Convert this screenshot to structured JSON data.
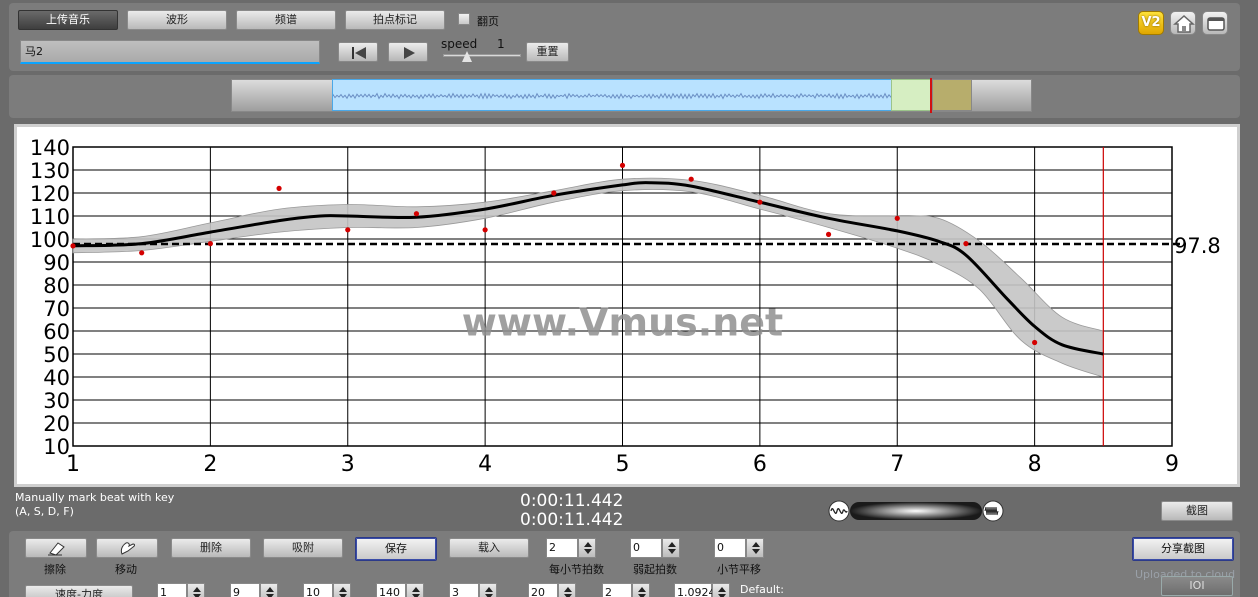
{
  "toolbar": {
    "upload_label": "上传音乐",
    "waveform_label": "波形",
    "spectrum_label": "频谱",
    "beat_mark_label": "拍点标记",
    "page_turn_label": "翻页",
    "song_title": "马2",
    "speed_label": "speed",
    "speed_value": "1",
    "reset_label": "重置",
    "version_badge": "V2",
    "home_icon": "home-icon",
    "window_icon": "window-icon"
  },
  "chart_data": {
    "type": "line",
    "title": "",
    "xlabel": "",
    "ylabel": "",
    "xlim": [
      1,
      9
    ],
    "ylim": [
      10,
      140
    ],
    "x_ticks": [
      1,
      2,
      3,
      4,
      5,
      6,
      7,
      8,
      9
    ],
    "y_ticks": [
      10,
      20,
      30,
      40,
      50,
      60,
      70,
      80,
      90,
      100,
      110,
      120,
      130,
      140
    ],
    "grid": true,
    "watermark": "www.Vmus.net",
    "reference_line": {
      "y": 97.8,
      "label": "97.8",
      "style": "dashed"
    },
    "cursor_x": 8.5,
    "points": [
      {
        "x": 1.0,
        "y": 97
      },
      {
        "x": 1.5,
        "y": 94
      },
      {
        "x": 2.0,
        "y": 98
      },
      {
        "x": 2.5,
        "y": 122
      },
      {
        "x": 3.0,
        "y": 104
      },
      {
        "x": 3.5,
        "y": 111
      },
      {
        "x": 4.0,
        "y": 104
      },
      {
        "x": 4.5,
        "y": 120
      },
      {
        "x": 5.0,
        "y": 132
      },
      {
        "x": 5.5,
        "y": 126
      },
      {
        "x": 6.0,
        "y": 116
      },
      {
        "x": 6.5,
        "y": 102
      },
      {
        "x": 7.0,
        "y": 109
      },
      {
        "x": 7.5,
        "y": 98
      },
      {
        "x": 8.0,
        "y": 55
      }
    ],
    "smooth_curve": [
      {
        "x": 1.0,
        "y": 97
      },
      {
        "x": 1.5,
        "y": 98
      },
      {
        "x": 2.0,
        "y": 103
      },
      {
        "x": 2.5,
        "y": 108
      },
      {
        "x": 2.8,
        "y": 110
      },
      {
        "x": 3.0,
        "y": 110
      },
      {
        "x": 3.5,
        "y": 109.5
      },
      {
        "x": 4.0,
        "y": 113
      },
      {
        "x": 4.5,
        "y": 119
      },
      {
        "x": 5.0,
        "y": 123.5
      },
      {
        "x": 5.2,
        "y": 124.5
      },
      {
        "x": 5.5,
        "y": 123
      },
      {
        "x": 6.0,
        "y": 116
      },
      {
        "x": 6.5,
        "y": 109
      },
      {
        "x": 7.0,
        "y": 103.5
      },
      {
        "x": 7.3,
        "y": 99
      },
      {
        "x": 7.5,
        "y": 93
      },
      {
        "x": 7.8,
        "y": 74
      },
      {
        "x": 8.0,
        "y": 62
      },
      {
        "x": 8.2,
        "y": 54
      },
      {
        "x": 8.5,
        "y": 50
      }
    ],
    "band_upper": [
      {
        "x": 1.0,
        "y": 100
      },
      {
        "x": 1.5,
        "y": 101
      },
      {
        "x": 2.0,
        "y": 107
      },
      {
        "x": 2.5,
        "y": 113
      },
      {
        "x": 3.0,
        "y": 115
      },
      {
        "x": 3.5,
        "y": 114
      },
      {
        "x": 4.0,
        "y": 116
      },
      {
        "x": 4.5,
        "y": 121
      },
      {
        "x": 5.0,
        "y": 126
      },
      {
        "x": 5.5,
        "y": 125.5
      },
      {
        "x": 6.0,
        "y": 119
      },
      {
        "x": 6.5,
        "y": 111
      },
      {
        "x": 7.0,
        "y": 110
      },
      {
        "x": 7.3,
        "y": 109
      },
      {
        "x": 7.6,
        "y": 99
      },
      {
        "x": 7.9,
        "y": 83
      },
      {
        "x": 8.2,
        "y": 66
      },
      {
        "x": 8.5,
        "y": 60
      }
    ],
    "band_lower": [
      {
        "x": 1.0,
        "y": 94
      },
      {
        "x": 1.5,
        "y": 95
      },
      {
        "x": 2.0,
        "y": 99
      },
      {
        "x": 2.5,
        "y": 103
      },
      {
        "x": 3.0,
        "y": 105
      },
      {
        "x": 3.5,
        "y": 105
      },
      {
        "x": 4.0,
        "y": 109
      },
      {
        "x": 4.5,
        "y": 116
      },
      {
        "x": 5.0,
        "y": 121
      },
      {
        "x": 5.5,
        "y": 120.5
      },
      {
        "x": 6.0,
        "y": 113
      },
      {
        "x": 6.5,
        "y": 105
      },
      {
        "x": 7.0,
        "y": 96
      },
      {
        "x": 7.3,
        "y": 89
      },
      {
        "x": 7.6,
        "y": 78
      },
      {
        "x": 7.9,
        "y": 56
      },
      {
        "x": 8.2,
        "y": 46
      },
      {
        "x": 8.5,
        "y": 40
      }
    ],
    "colors": {
      "curve": "#000000",
      "band": "#c4c4c4",
      "points": "#d40000",
      "cursor": "#cc0000"
    }
  },
  "status": {
    "hint_line1": "Manually mark beat with key",
    "hint_line2": "(A, S, D, F)",
    "time_1": "0:00:11.442",
    "time_2": "0:00:11.442",
    "screenshot_label": "截图"
  },
  "bottom": {
    "erase_label": "擦除",
    "move_label": "移动",
    "delete_label": "删除",
    "attach_label": "吸附",
    "save_label": "保存",
    "load_label": "载入",
    "beats_per_bar_value": "2",
    "beats_per_bar_label": "每小节拍数",
    "pickup_value": "0",
    "pickup_label": "弱起拍数",
    "bar_shift_value": "0",
    "bar_shift_label": "小节平移",
    "share_label": "分享截图",
    "uploaded_label": "Uploaded to cloud",
    "tempo_force_label": "速度-力度",
    "fields": [
      "1",
      "9",
      "10",
      "140",
      "3",
      "20",
      "2",
      "1.0924"
    ],
    "default_label": "Default:",
    "io_label": "IOI"
  }
}
